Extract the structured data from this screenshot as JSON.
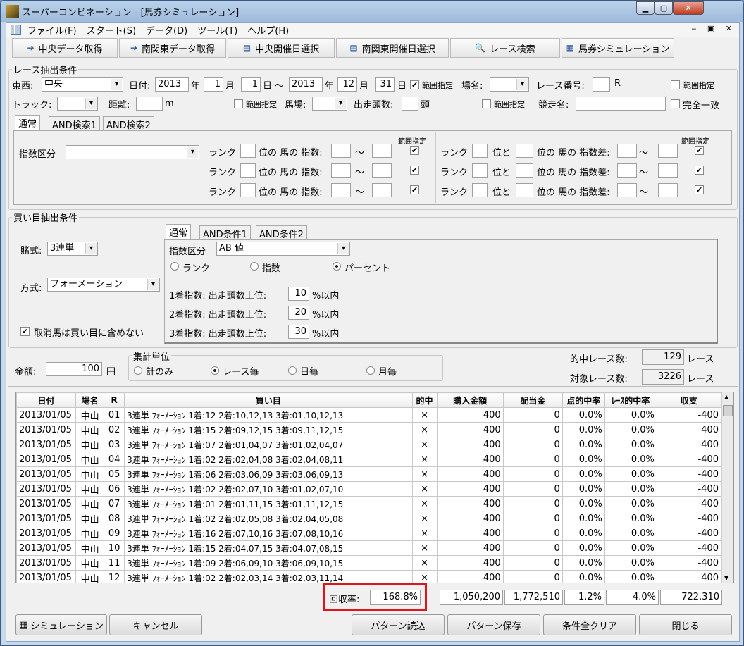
{
  "window": {
    "title": "スーパーコンビネーション - [馬券シミュレーション]"
  },
  "menu": [
    "ファイル(F)",
    "スタート(S)",
    "データ(D)",
    "ツール(T)",
    "ヘルプ(H)"
  ],
  "toolbar": [
    {
      "label": "中央データ取得",
      "icon": "arrow-icon"
    },
    {
      "label": "南関東データ取得",
      "icon": "arrow-icon"
    },
    {
      "label": "中央開催日選択",
      "icon": "calendar-icon"
    },
    {
      "label": "南関東開催日選択",
      "icon": "calendar-icon"
    },
    {
      "label": "レース検索",
      "icon": "search-icon"
    },
    {
      "label": "馬券シミュレーション",
      "icon": "table-icon"
    }
  ],
  "race": {
    "group": "レース抽出条件",
    "east_west_label": "東西:",
    "east_west": "中央",
    "date_label": "日付:",
    "from_year": "2013",
    "year": "年",
    "from_month": "1",
    "month": "月",
    "from_day": "1",
    "day": "日 ～",
    "to_year": "2013",
    "to_month": "12",
    "to_day": "31",
    "day2": "日",
    "range": "範囲指定",
    "place_label": "場名:",
    "race_no_label": "レース番号:",
    "r": "R",
    "track_label": "トラック:",
    "distance_label": "距離:",
    "m": "m",
    "baba_label": "馬場:",
    "heads_label": "出走頭数:",
    "tou": "頭",
    "race_name_label": "競走名:",
    "exact": "完全一致",
    "tabs": [
      "通常",
      "AND検索1",
      "AND検索2"
    ],
    "index_label": "指数区分",
    "rank": "ランク",
    "horse_index": "位の 馬の 指数:",
    "tilde": "～",
    "to": "位と",
    "horse_diff": "位の 馬の 指数差:"
  },
  "buy": {
    "group": "買い目抽出条件",
    "bet_label": "賭式:",
    "bet": "3連単",
    "method_label": "方式:",
    "method": "フォーメーション",
    "exclude": "取消馬は買い目に含めない",
    "tabs": [
      "通常",
      "AND条件1",
      "AND条件2"
    ],
    "index_label": "指数区分",
    "index": "AB 値",
    "radios": [
      "ランク",
      "指数",
      "パーセント"
    ],
    "rows": [
      {
        "label": "1着指数: 出走頭数上位:",
        "value": "10",
        "unit": "%以内"
      },
      {
        "label": "2着指数: 出走頭数上位:",
        "value": "20",
        "unit": "%以内"
      },
      {
        "label": "3着指数: 出走頭数上位:",
        "value": "30",
        "unit": "%以内"
      }
    ]
  },
  "amount": {
    "label": "金額:",
    "value": "100",
    "unit": "円",
    "group": "集計単位",
    "options": [
      "計のみ",
      "レース毎",
      "日毎",
      "月毎"
    ],
    "hit_label": "的中レース数:",
    "hit": "129",
    "target_label": "対象レース数:",
    "target": "3226",
    "race_unit": "レース"
  },
  "table": {
    "headers": [
      "日付",
      "場名",
      "R",
      "買い目",
      "的中",
      "購入金額",
      "配当金",
      "点的中率",
      "ﾚｰｽ的中率",
      "収支"
    ],
    "rows": [
      [
        "2013/01/05",
        "中山",
        "01",
        "3連単 ﾌｫｰﾒｰｼｮﾝ 1着:12 2着:10,12,13 3着:01,10,12,13",
        "×",
        "400",
        "0",
        "0.0%",
        "0.0%",
        "-400"
      ],
      [
        "2013/01/05",
        "中山",
        "02",
        "3連単 ﾌｫｰﾒｰｼｮﾝ 1着:15 2着:09,12,15 3着:09,11,12,15",
        "×",
        "400",
        "0",
        "0.0%",
        "0.0%",
        "-400"
      ],
      [
        "2013/01/05",
        "中山",
        "03",
        "3連単 ﾌｫｰﾒｰｼｮﾝ 1着:07 2着:01,04,07 3着:01,02,04,07",
        "×",
        "400",
        "0",
        "0.0%",
        "0.0%",
        "-400"
      ],
      [
        "2013/01/05",
        "中山",
        "04",
        "3連単 ﾌｫｰﾒｰｼｮﾝ 1着:02 2着:02,04,08 3着:02,04,08,11",
        "×",
        "400",
        "0",
        "0.0%",
        "0.0%",
        "-400"
      ],
      [
        "2013/01/05",
        "中山",
        "05",
        "3連単 ﾌｫｰﾒｰｼｮﾝ 1着:06 2着:03,06,09 3着:03,06,09,13",
        "×",
        "400",
        "0",
        "0.0%",
        "0.0%",
        "-400"
      ],
      [
        "2013/01/05",
        "中山",
        "06",
        "3連単 ﾌｫｰﾒｰｼｮﾝ 1着:02 2着:02,07,10 3着:01,02,07,10",
        "×",
        "400",
        "0",
        "0.0%",
        "0.0%",
        "-400"
      ],
      [
        "2013/01/05",
        "中山",
        "07",
        "3連単 ﾌｫｰﾒｰｼｮﾝ 1着:01 2着:01,11,15 3着:01,11,12,15",
        "×",
        "400",
        "0",
        "0.0%",
        "0.0%",
        "-400"
      ],
      [
        "2013/01/05",
        "中山",
        "08",
        "3連単 ﾌｫｰﾒｰｼｮﾝ 1着:02 2着:02,05,08 3着:02,04,05,08",
        "×",
        "400",
        "0",
        "0.0%",
        "0.0%",
        "-400"
      ],
      [
        "2013/01/05",
        "中山",
        "09",
        "3連単 ﾌｫｰﾒｰｼｮﾝ 1着:16 2着:07,10,16 3着:07,08,10,16",
        "×",
        "400",
        "0",
        "0.0%",
        "0.0%",
        "-400"
      ],
      [
        "2013/01/05",
        "中山",
        "10",
        "3連単 ﾌｫｰﾒｰｼｮﾝ 1着:15 2着:04,07,15 3着:04,07,08,15",
        "×",
        "400",
        "0",
        "0.0%",
        "0.0%",
        "-400"
      ],
      [
        "2013/01/05",
        "中山",
        "11",
        "3連単 ﾌｫｰﾒｰｼｮﾝ 1着:09 2着:06,09,10 3着:06,09,10,15",
        "×",
        "400",
        "0",
        "0.0%",
        "0.0%",
        "-400"
      ],
      [
        "2013/01/05",
        "中山",
        "12",
        "3連単 ﾌｫｰﾒｰｼｮﾝ 1着:02 2着:02,03,14 3着:02,03,11,14",
        "×",
        "400",
        "0",
        "0.0%",
        "0.0%",
        "-400"
      ]
    ]
  },
  "totals": {
    "recovery_label": "回収率:",
    "recovery": "168.8%",
    "purchase": "1,050,200",
    "payout": "1,772,510",
    "point_hit": "1.2%",
    "race_hit": "4.0%",
    "balance": "722,310"
  },
  "buttons": {
    "simulate": "シミュレーション",
    "cancel": "キャンセル",
    "load": "パターン読込",
    "save": "パターン保存",
    "clear": "条件全クリア",
    "close": "閉じる"
  },
  "colors": {
    "highlight": "#e0141c"
  }
}
